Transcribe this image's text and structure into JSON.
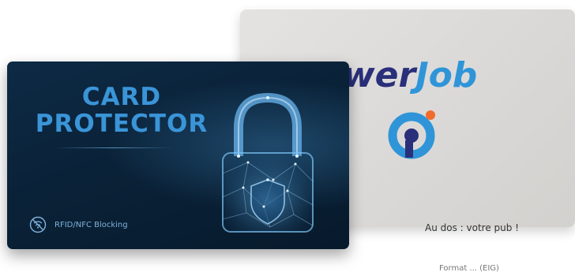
{
  "back_card": {
    "brand_part1": "wer",
    "brand_part2": "Job"
  },
  "front_card": {
    "title_line1": "CARD",
    "title_line2": "PROTECTOR",
    "feature_label": "RFID/NFC Blocking"
  },
  "caption": "Au dos : votre pub !",
  "caption_partial": "Format ... (EIG)",
  "colors": {
    "front_bg": "#0a2238",
    "title_blue": "#3a95d8",
    "brand_navy": "#2a2f7a",
    "brand_blue": "#2f95d8",
    "logo_orange": "#f26b2a",
    "back_bg": "#dedcda"
  }
}
